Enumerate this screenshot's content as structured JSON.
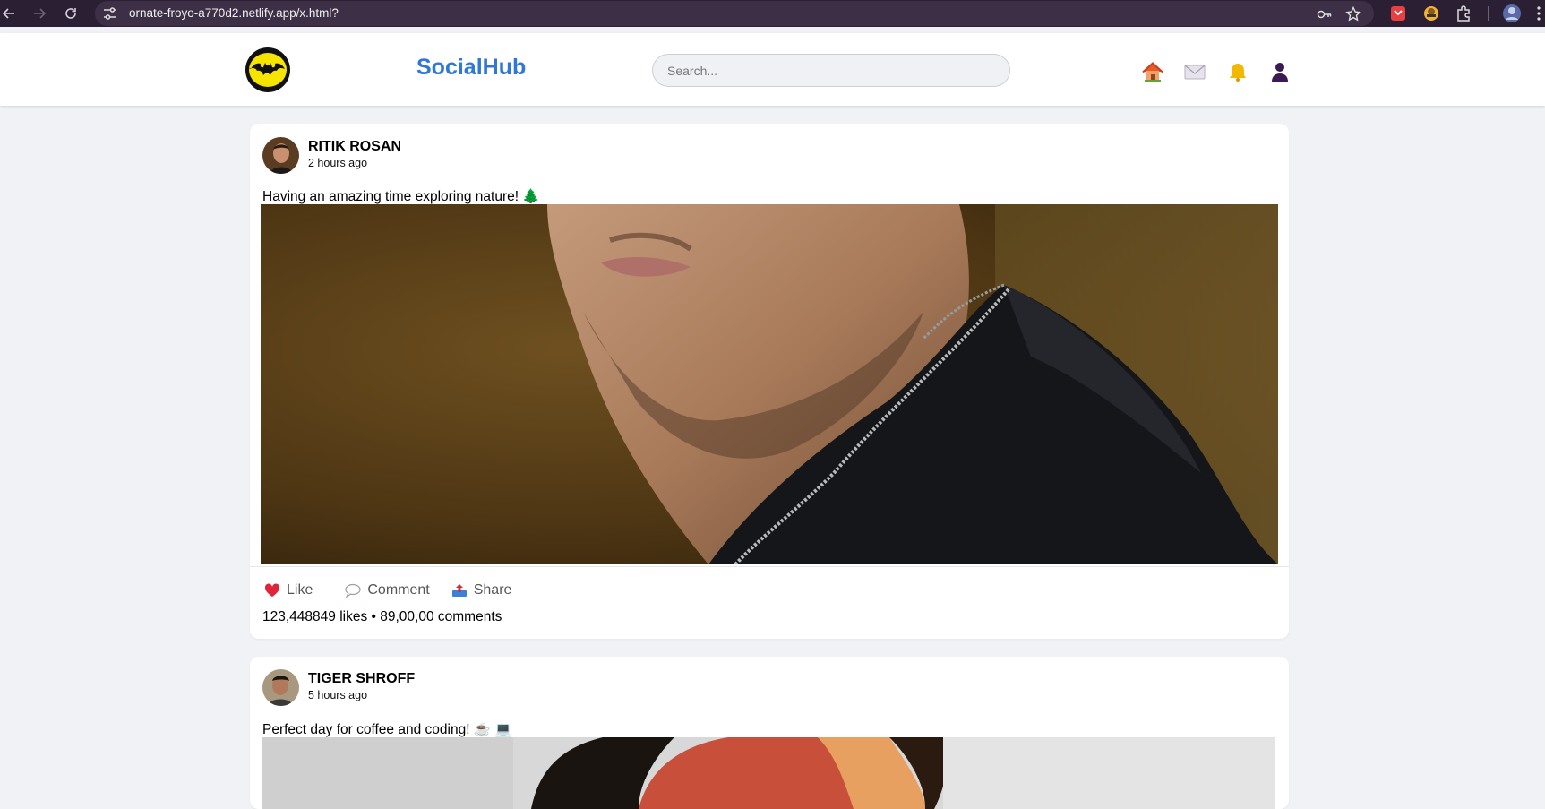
{
  "browser": {
    "url": "ornate-froyo-a770d2.netlify.app/x.html?"
  },
  "header": {
    "brand": "SocialHub",
    "search_placeholder": "Search..."
  },
  "posts": [
    {
      "author": "RITIK ROSAN",
      "time": "2 hours ago",
      "caption": "Having an amazing time exploring nature! 🌲",
      "actions": {
        "like": "Like",
        "comment": "Comment",
        "share": "Share"
      },
      "stats": "123,448849 likes • 89,00,00 comments"
    },
    {
      "author": "TIGER SHROFF",
      "time": "5 hours ago",
      "caption": "Perfect day for coffee and coding! ☕ 💻"
    }
  ],
  "colors": {
    "brand": "#2f78d6",
    "browser_bg": "#2b1f33",
    "like": "#e0243a"
  }
}
